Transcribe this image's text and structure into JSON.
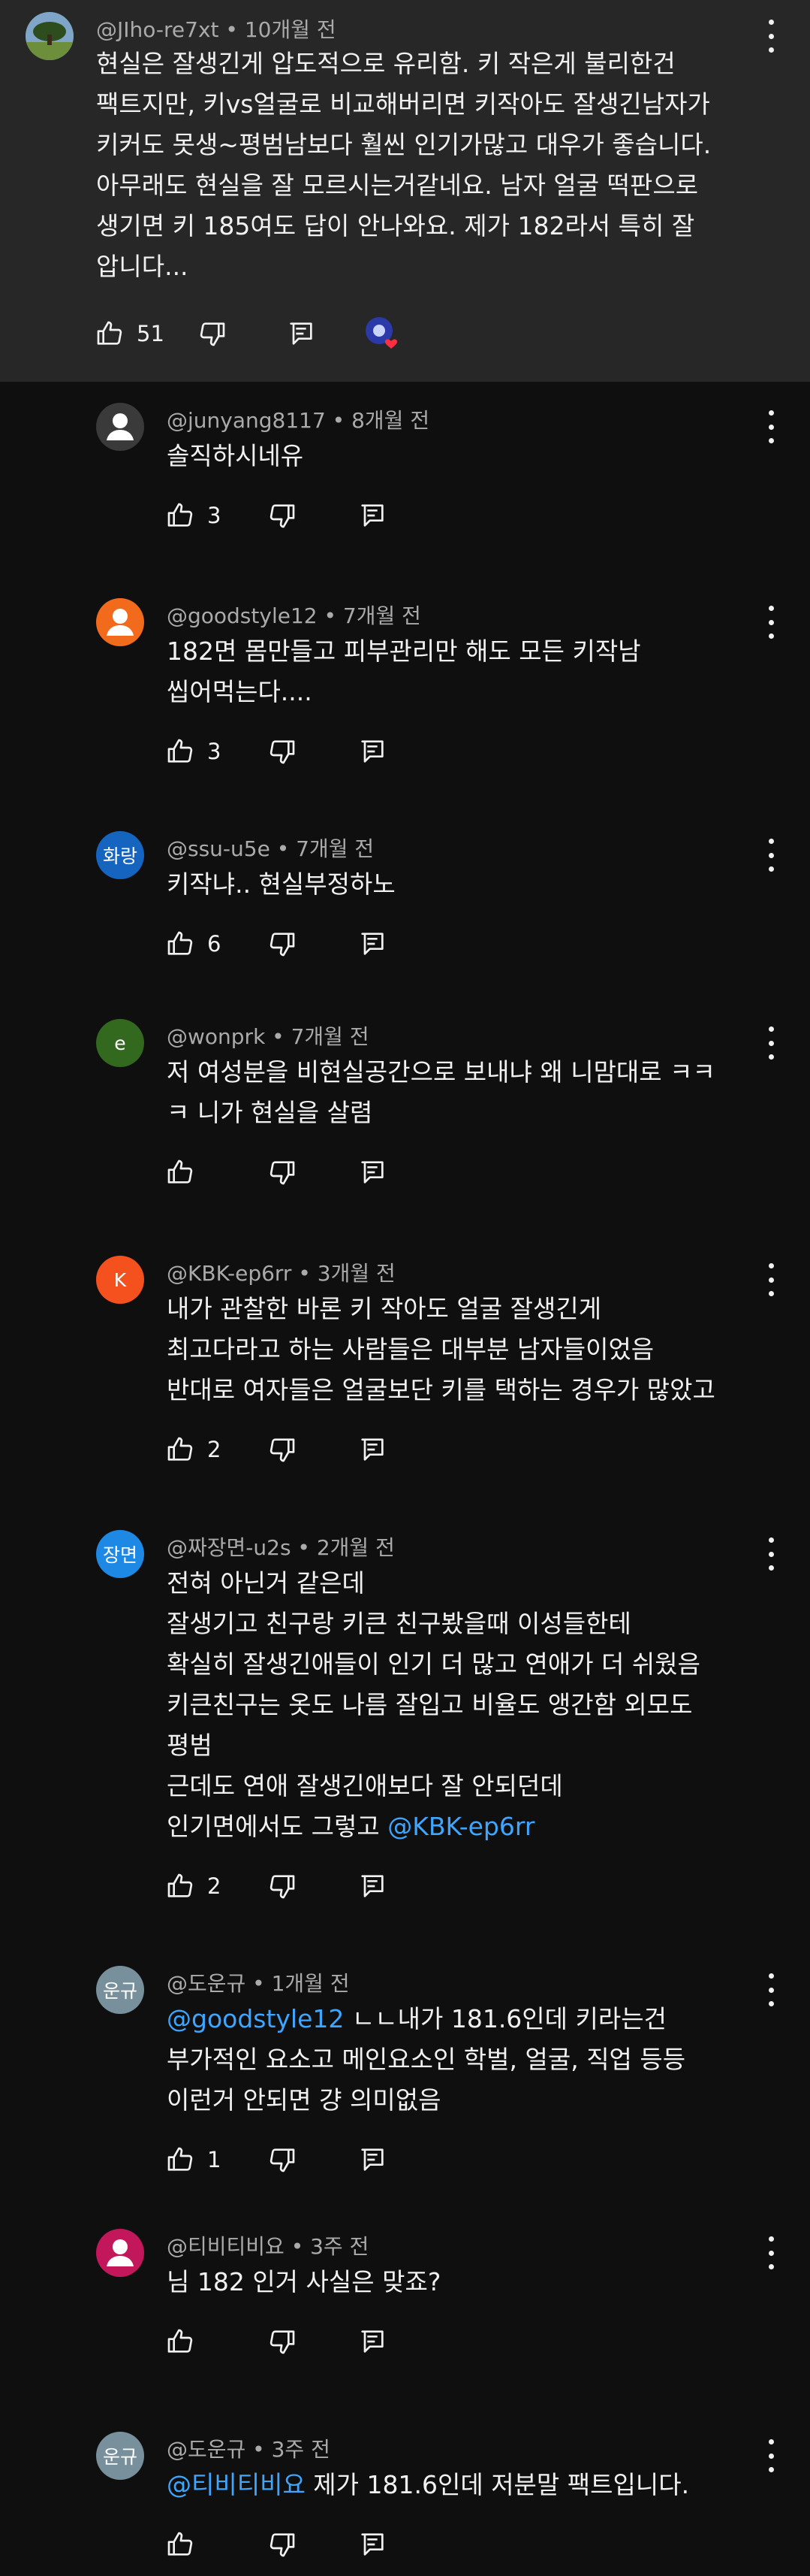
{
  "colors": {
    "background": "#0f0f0f",
    "parent_background": "#272727",
    "text": "#f1f1f1",
    "meta": "#aaaaaa",
    "mention": "#3ea6ff"
  },
  "parent": {
    "author_meta": "@JIho-re7xt • 10개월 전",
    "lines": [
      "현실은 잘생긴게 압도적으로 유리함. 키 작은게 불리한건",
      "팩트지만, 키vs얼굴로 비교해버리면 키작아도 잘생긴남자가",
      "키커도 못생~평범남보다 훨씬 인기가많고 대우가 좋습니다.",
      "아무래도 현실을 잘 모르시는거같네요. 남자 얼굴 떡판으로",
      "생기면 키 185여도 답이 안나와요. 제가 182라서 특히 잘",
      "압니다..."
    ],
    "like_count": "51"
  },
  "replies": [
    {
      "author_meta": "@junyang8117 • 8개월 전",
      "avatar_text": "",
      "avatar_color": "#3a3a3a",
      "lines": [
        "솔직하시네유"
      ],
      "like_count": "3"
    },
    {
      "author_meta": "@goodstyle12 • 7개월 전",
      "avatar_text": "",
      "avatar_color": "#f26b1d",
      "lines": [
        "182면 몸만들고 피부관리만 해도 모든 키작남",
        "씹어먹는다...."
      ],
      "like_count": "3"
    },
    {
      "author_meta": "@ssu-u5e • 7개월 전",
      "avatar_text": "화랑",
      "avatar_color": "#1565c0",
      "lines": [
        "키작냐.. 현실부정하노"
      ],
      "like_count": "6"
    },
    {
      "author_meta": "@wonprk • 7개월 전",
      "avatar_text": "e",
      "avatar_color": "#33691e",
      "lines": [
        "저 여성분을 비현실공간으로 보내냐 왜 니맘대로 ㅋㅋ",
        "ㅋ 니가 현실을 살렴"
      ],
      "like_count": ""
    },
    {
      "author_meta": "@KBK-ep6rr • 3개월 전",
      "avatar_text": "K",
      "avatar_color": "#f4511e",
      "lines": [
        "내가 관찰한 바론 키 작아도 얼굴 잘생긴게",
        "최고다라고 하는 사람들은 대부분 남자들이었음",
        "반대로 여자들은 얼굴보단 키를 택하는 경우가 많았고"
      ],
      "like_count": "2"
    },
    {
      "author_meta": "@짜장면-u2s • 2개월 전",
      "avatar_text": "장면",
      "avatar_color": "#1e88e5",
      "lines": [
        "전혀 아닌거 같은데",
        "잘생기고 친구랑  키큰 친구봤을때 이성들한테",
        "확실히 잘생긴애들이 인기 더 많고  연애가 더 쉬웠음",
        "키큰친구는 옷도 나름 잘입고 비율도 앵간함  외모도",
        "평범",
        "근데도  연애  잘생긴애보다 잘 안되던데",
        "인기면에서도 그렇고 "
      ],
      "mention_line": 6,
      "mention": "@KBK-ep6rr",
      "like_count": "2"
    },
    {
      "author_meta": "@도운규 • 1개월 전",
      "avatar_text": "운규",
      "avatar_color": "#78909c",
      "lines": [
        " ㄴㄴ내가 181.6인데 키라는건",
        "부가적인 요소고 메인요소인 학벌, 얼굴, 직업 등등",
        "이런거 안되면 걍 의미없음"
      ],
      "mention_line": 0,
      "mention_prefix": " ",
      "mention": "@goodstyle12",
      "like_count": "1"
    },
    {
      "author_meta": "@티비티비요 • 3주 전",
      "avatar_text": "",
      "avatar_color": "#c2185b",
      "lines": [
        "님 182 인거 사실은 맞죠?"
      ],
      "like_count": ""
    },
    {
      "author_meta": "@도운규 • 3주 전",
      "avatar_text": "운규",
      "avatar_color": "#78909c",
      "lines": [
        "  제가 181.6인데 저분말 팩트입니다."
      ],
      "mention_line": 0,
      "mention_prefix": " ",
      "mention": "@티비티비요",
      "like_count": ""
    }
  ]
}
